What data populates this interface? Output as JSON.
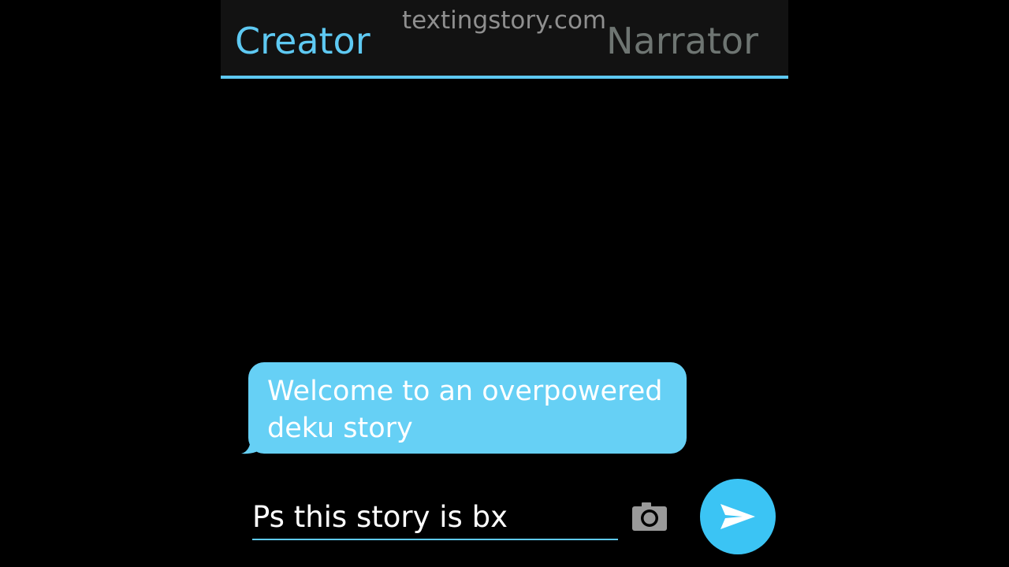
{
  "header": {
    "tab_active_label": "Creator",
    "tab_inactive_label": "Narrator",
    "watermark": "textingstory.com"
  },
  "conversation": {
    "messages": [
      {
        "sender": "Creator",
        "text": "Welcome to an overpowered deku story"
      }
    ]
  },
  "composer": {
    "value": "Ps this story is bx",
    "camera_icon": "camera-icon",
    "send_icon": "send-icon"
  },
  "colors": {
    "accent": "#5ec9f2",
    "bubble": "#66d0f5",
    "send_button": "#3bc4f4",
    "inactive_tab": "#6e7572",
    "watermark": "#8f8f8f",
    "topbar": "#121212",
    "background": "#000000"
  }
}
